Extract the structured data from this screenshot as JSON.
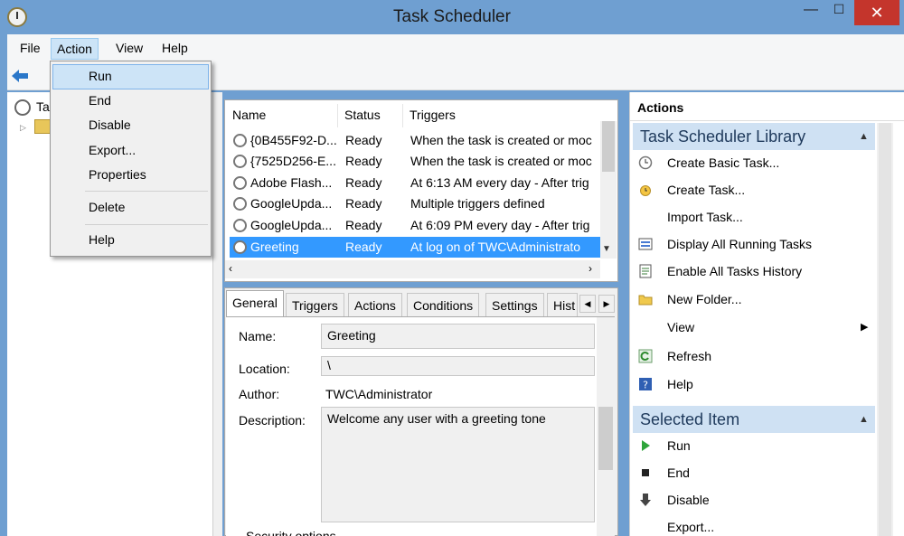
{
  "window": {
    "title": "Task Scheduler",
    "minimize": "—",
    "maximize": "☐",
    "close": "✕"
  },
  "menubar": {
    "file": "File",
    "action": "Action",
    "view": "View",
    "help": "Help"
  },
  "tree": {
    "root_label": "Ta"
  },
  "action_menu": {
    "items": [
      "Run",
      "End",
      "Disable",
      "Export...",
      "Properties",
      "Delete",
      "Help"
    ],
    "highlighted": "Run"
  },
  "task_list": {
    "columns": [
      "Name",
      "Status",
      "Triggers"
    ],
    "rows": [
      {
        "name": "{0B455F92-D...",
        "status": "Ready",
        "trigger": "When the task is created or moc"
      },
      {
        "name": "{7525D256-E...",
        "status": "Ready",
        "trigger": "When the task is created or moc"
      },
      {
        "name": "Adobe Flash...",
        "status": "Ready",
        "trigger": "At 6:13 AM every day - After trig"
      },
      {
        "name": "GoogleUpda...",
        "status": "Ready",
        "trigger": "Multiple triggers defined"
      },
      {
        "name": "GoogleUpda...",
        "status": "Ready",
        "trigger": "At 6:09 PM every day - After trig"
      },
      {
        "name": "Greeting",
        "status": "Ready",
        "trigger": "At log on of TWC\\Administrato"
      }
    ],
    "selected_row": "Greeting"
  },
  "details": {
    "tabs": [
      "General",
      "Triggers",
      "Actions",
      "Conditions",
      "Settings",
      "Hist"
    ],
    "active_tab": "General",
    "name_label": "Name:",
    "name_value": "Greeting",
    "location_label": "Location:",
    "location_value": "\\",
    "author_label": "Author:",
    "author_value": "TWC\\Administrator",
    "description_label": "Description:",
    "description_value": "Welcome any user with a greeting tone",
    "security_label": "Security options"
  },
  "actions_pane": {
    "header": "Actions",
    "library_section": "Task Scheduler Library",
    "library_actions": [
      "Create Basic Task...",
      "Create Task...",
      "Import Task...",
      "Display All Running Tasks",
      "Enable All Tasks History",
      "New Folder...",
      "View",
      "Refresh",
      "Help"
    ],
    "selected_section": "Selected Item",
    "selected_actions": [
      "Run",
      "End",
      "Disable",
      "Export..."
    ]
  },
  "colors": {
    "title_bar": "#6f9fd1",
    "selection": "#3399ff",
    "section_header": "#cfe1f3",
    "close_button": "#c4352c"
  }
}
